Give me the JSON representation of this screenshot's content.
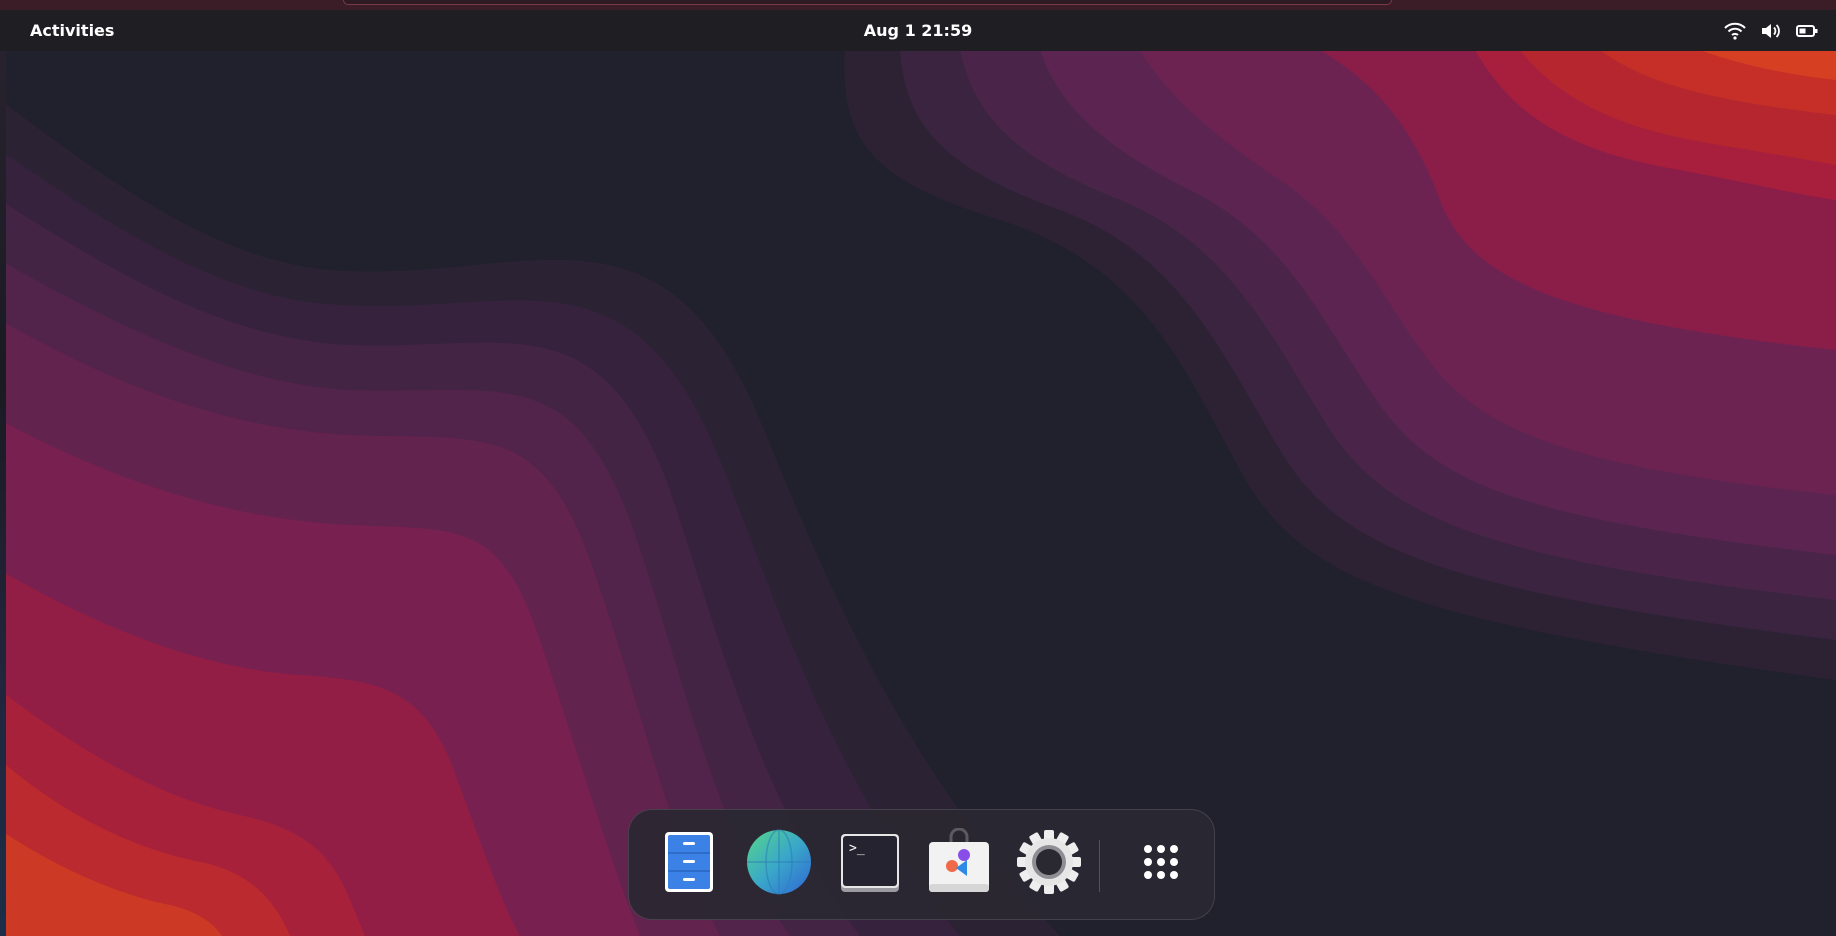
{
  "topbar": {
    "activities_label": "Activities",
    "clock": "Aug 1 21:59",
    "status_icons": [
      "wifi-icon",
      "volume-icon",
      "battery-icon"
    ]
  },
  "dock": {
    "items": [
      {
        "name": "Files",
        "icon": "files-icon"
      },
      {
        "name": "Web Browser",
        "icon": "globe-icon"
      },
      {
        "name": "Terminal",
        "icon": "terminal-icon",
        "glyph": ">_"
      },
      {
        "name": "App Center",
        "icon": "app-center-icon"
      },
      {
        "name": "Settings",
        "icon": "gear-icon"
      },
      {
        "name": "Show Apps",
        "icon": "app-grid-icon"
      }
    ]
  },
  "colors": {
    "topbar": "#1f1e23",
    "wallpaper_dark": "#21202d",
    "wallpaper_purple": "#6d2150",
    "wallpaper_red": "#a01c3e",
    "wallpaper_orange": "#d23b26",
    "dock_background": "#2a2832"
  }
}
